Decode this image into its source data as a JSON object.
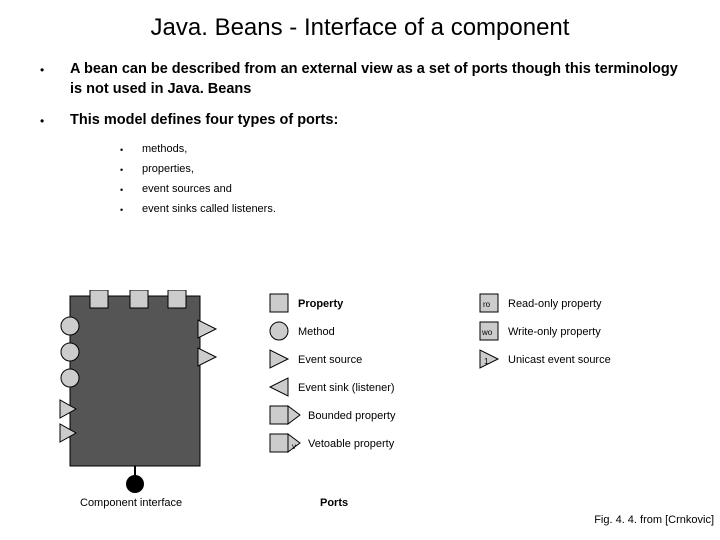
{
  "title": "Java. Beans - Interface of a component",
  "bullets": [
    "A bean can be described from an external view as a set of ports though this terminology is not used in Java. Beans",
    "This model defines four types of ports:"
  ],
  "subbullets": [
    "methods,",
    "properties,",
    "event sources and",
    "event sinks called listeners."
  ],
  "legend": {
    "left_footer": "Component interface",
    "col2_header": "Ports",
    "col2": [
      "Property",
      "Method",
      "Event source",
      "Event sink (listener)",
      "Bounded property",
      "Vetoable property"
    ],
    "col3_tags": [
      "ro",
      "wo",
      "1"
    ],
    "col3": [
      "Read-only property",
      "Write-only property",
      "Unicast event source"
    ],
    "v_tag": "v"
  },
  "caption": "Fig. 4. 4. from [Crnkovic]"
}
